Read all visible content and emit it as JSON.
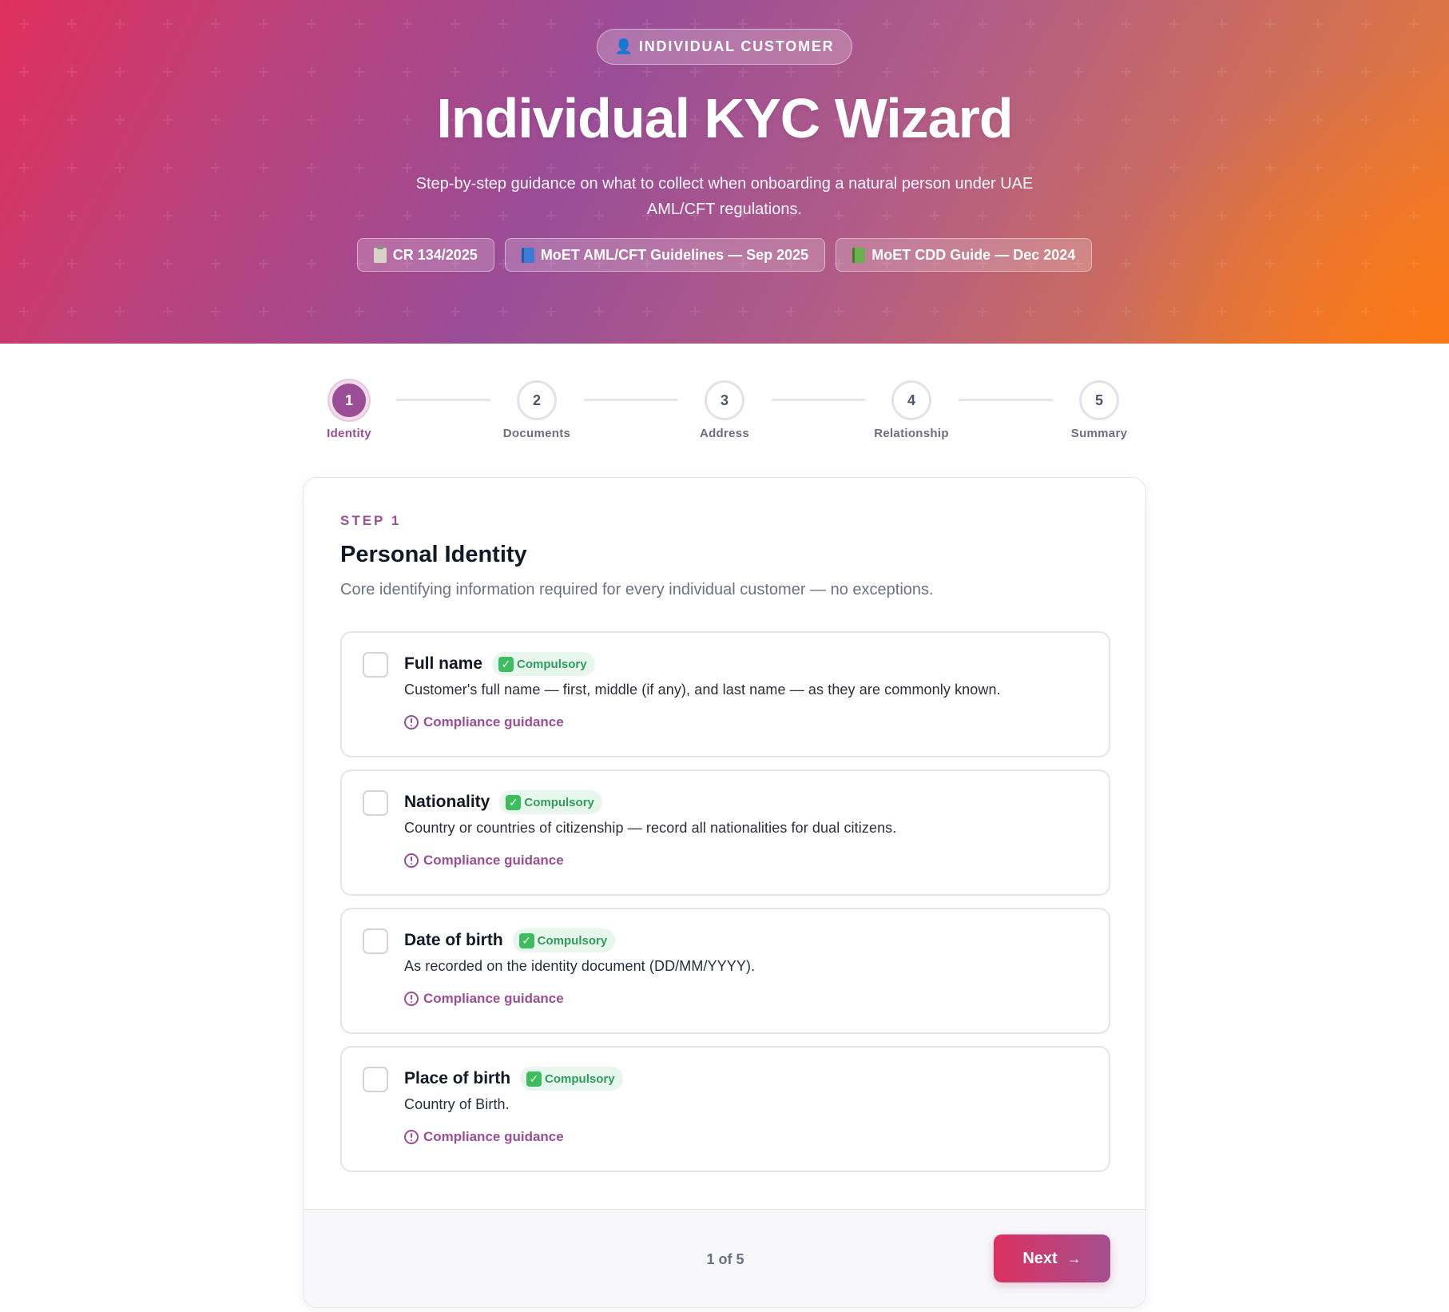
{
  "hero": {
    "badge_icon": "person-icon",
    "badge_label": "INDIVIDUAL CUSTOMER",
    "title": "Individual KYC Wizard",
    "subtitle": "Step-by-step guidance on what to collect when onboarding a natural person under UAE AML/CFT regulations.",
    "references": [
      {
        "icon": "clipboard-icon",
        "label": "CR 134/2025"
      },
      {
        "icon": "blue-book-icon",
        "label": "MoET AML/CFT Guidelines — Sep 2025"
      },
      {
        "icon": "green-book-icon",
        "label": "MoET CDD Guide — Dec 2024"
      }
    ]
  },
  "stepper": {
    "current": 1,
    "steps": [
      {
        "number": "1",
        "label": "Identity"
      },
      {
        "number": "2",
        "label": "Documents"
      },
      {
        "number": "3",
        "label": "Address"
      },
      {
        "number": "4",
        "label": "Relationship"
      },
      {
        "number": "5",
        "label": "Summary"
      }
    ]
  },
  "card": {
    "eyebrow": "STEP 1",
    "title": "Personal Identity",
    "description": "Core identifying information required for every individual customer — no exceptions.",
    "items": [
      {
        "name": "Full name",
        "badge": "Compulsory",
        "description": "Customer's full name — first, middle (if any), and last name — as they are commonly known.",
        "guidance": "Compliance guidance",
        "checked": false
      },
      {
        "name": "Nationality",
        "badge": "Compulsory",
        "description": "Country or countries of citizenship — record all nationalities for dual citizens.",
        "guidance": "Compliance guidance",
        "checked": false
      },
      {
        "name": "Date of birth",
        "badge": "Compulsory",
        "description": "As recorded on the identity document (DD/MM/YYYY).",
        "guidance": "Compliance guidance",
        "checked": false
      },
      {
        "name": "Place of birth",
        "badge": "Compulsory",
        "description": "Country of Birth.",
        "guidance": "Compliance guidance",
        "checked": false
      }
    ],
    "footer": {
      "page_indicator": "1 of 5",
      "next_label": "Next"
    }
  },
  "colors": {
    "accent": "#9b4e96",
    "badge_green": "#2e9d5b",
    "hero_start": "#e0305c",
    "hero_end": "#f07c2a"
  }
}
